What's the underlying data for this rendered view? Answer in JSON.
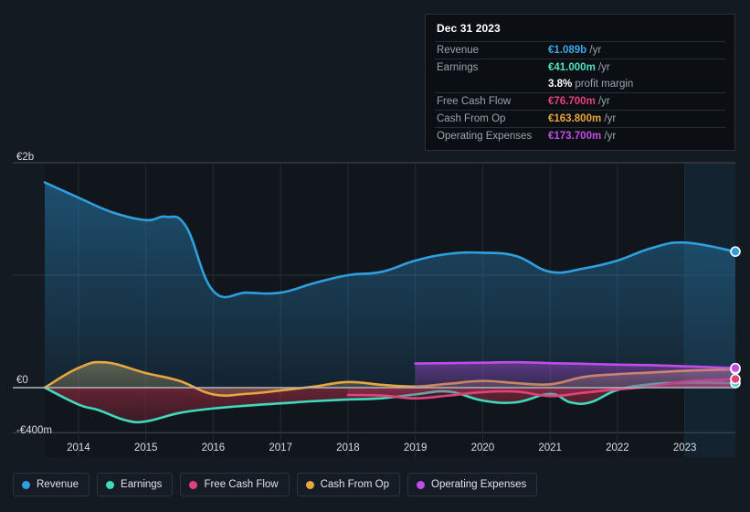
{
  "tooltip": {
    "title": "Dec 31 2023",
    "rows": [
      {
        "label": "Revenue",
        "amount": "€1.089b",
        "unit": "/yr",
        "color": "#3ba9e8"
      },
      {
        "label": "Earnings",
        "amount": "€41.000m",
        "unit": "/yr",
        "color": "#4fe3c1"
      },
      {
        "label": "Free Cash Flow",
        "amount": "€76.700m",
        "unit": "/yr",
        "color": "#e8417e"
      },
      {
        "label": "Cash From Op",
        "amount": "€163.800m",
        "unit": "/yr",
        "color": "#eaa53c"
      },
      {
        "label": "Operating Expenses",
        "amount": "€173.700m",
        "unit": "/yr",
        "color": "#c24de8"
      }
    ],
    "profit_margin_value": "3.8%",
    "profit_margin_label": "profit margin"
  },
  "legend": {
    "items": [
      {
        "label": "Revenue",
        "color": "#2f9fe0"
      },
      {
        "label": "Earnings",
        "color": "#3fd9bd"
      },
      {
        "label": "Free Cash Flow",
        "color": "#e0437c"
      },
      {
        "label": "Cash From Op",
        "color": "#e9a63f"
      },
      {
        "label": "Operating Expenses",
        "color": "#c14de8"
      }
    ]
  },
  "chart_data": {
    "type": "area",
    "title": "",
    "xlabel": "",
    "ylabel": "",
    "grid": true,
    "legend_position": "bottom",
    "currency": "EUR",
    "x": [
      2013.5,
      2014,
      2014.5,
      2015,
      2015.5,
      2016,
      2016.5,
      2017,
      2017.5,
      2018,
      2018.5,
      2019,
      2019.5,
      2020,
      2020.5,
      2021,
      2021.5,
      2022,
      2022.5,
      2023,
      2023.75
    ],
    "xtick_labels": [
      "2014",
      "2015",
      "2016",
      "2017",
      "2018",
      "2019",
      "2020",
      "2021",
      "2022",
      "2023"
    ],
    "xticks": [
      2014,
      2015,
      2016,
      2017,
      2018,
      2019,
      2020,
      2021,
      2022,
      2023
    ],
    "ytick_labels": [
      "€2b",
      "€0",
      "-€400m"
    ],
    "yticks": [
      2000,
      0,
      -400
    ],
    "ylim": [
      -450,
      2050
    ],
    "units": "millions of EUR",
    "series": [
      {
        "name": "Revenue",
        "color": "#2f9fe0",
        "fill": "#1d4károly",
        "x": [
          2013.5,
          2014,
          2014.5,
          2015,
          2015.3,
          2015.6,
          2016,
          2016.5,
          2017,
          2017.5,
          2018,
          2018.5,
          2019,
          2019.5,
          2020,
          2020.5,
          2021,
          2021.5,
          2022,
          2022.5,
          2023,
          2023.75
        ],
        "values": [
          1825,
          1690,
          1560,
          1490,
          1520,
          1430,
          860,
          845,
          845,
          930,
          1000,
          1030,
          1130,
          1190,
          1200,
          1170,
          1030,
          1060,
          1130,
          1240,
          1290,
          1210
        ]
      },
      {
        "name": "Earnings",
        "color": "#3fd9bd",
        "x": [
          2013.5,
          2014,
          2014.3,
          2014.7,
          2015,
          2015.5,
          2016,
          2016.5,
          2017,
          2017.5,
          2018,
          2018.5,
          2019,
          2019.5,
          2020,
          2020.5,
          2021,
          2021.3,
          2021.6,
          2022,
          2022.5,
          2023,
          2023.75
        ],
        "values": [
          0,
          -150,
          -200,
          -290,
          -300,
          -225,
          -185,
          -160,
          -140,
          -120,
          -105,
          -95,
          -60,
          -35,
          -115,
          -130,
          -55,
          -130,
          -130,
          -20,
          30,
          45,
          41
        ]
      },
      {
        "name": "Free Cash Flow",
        "color": "#e0437c",
        "x": [
          2018,
          2018.5,
          2019,
          2019.5,
          2020,
          2020.5,
          2021,
          2021.5,
          2022,
          2022.5,
          2023,
          2023.75
        ],
        "values": [
          -65,
          -70,
          -95,
          -70,
          -40,
          -35,
          -75,
          -45,
          -15,
          10,
          55,
          76.7
        ]
      },
      {
        "name": "Cash From Op",
        "color": "#e9a63f",
        "x": [
          2013.5,
          2014,
          2014.4,
          2015,
          2015.5,
          2016,
          2016.5,
          2017,
          2017.5,
          2018,
          2018.5,
          2019,
          2019.5,
          2020,
          2020.5,
          2021,
          2021.5,
          2022,
          2022.5,
          2023,
          2023.75
        ],
        "values": [
          0,
          175,
          225,
          130,
          60,
          -60,
          -55,
          -25,
          10,
          50,
          25,
          10,
          35,
          60,
          40,
          30,
          95,
          120,
          135,
          150,
          163.8
        ]
      },
      {
        "name": "Operating Expenses",
        "color": "#c14de8",
        "x": [
          2019,
          2019.5,
          2020,
          2020.5,
          2021,
          2021.5,
          2022,
          2022.5,
          2023,
          2023.75
        ],
        "values": [
          215,
          218,
          222,
          226,
          218,
          212,
          205,
          200,
          190,
          173.7
        ]
      }
    ]
  }
}
